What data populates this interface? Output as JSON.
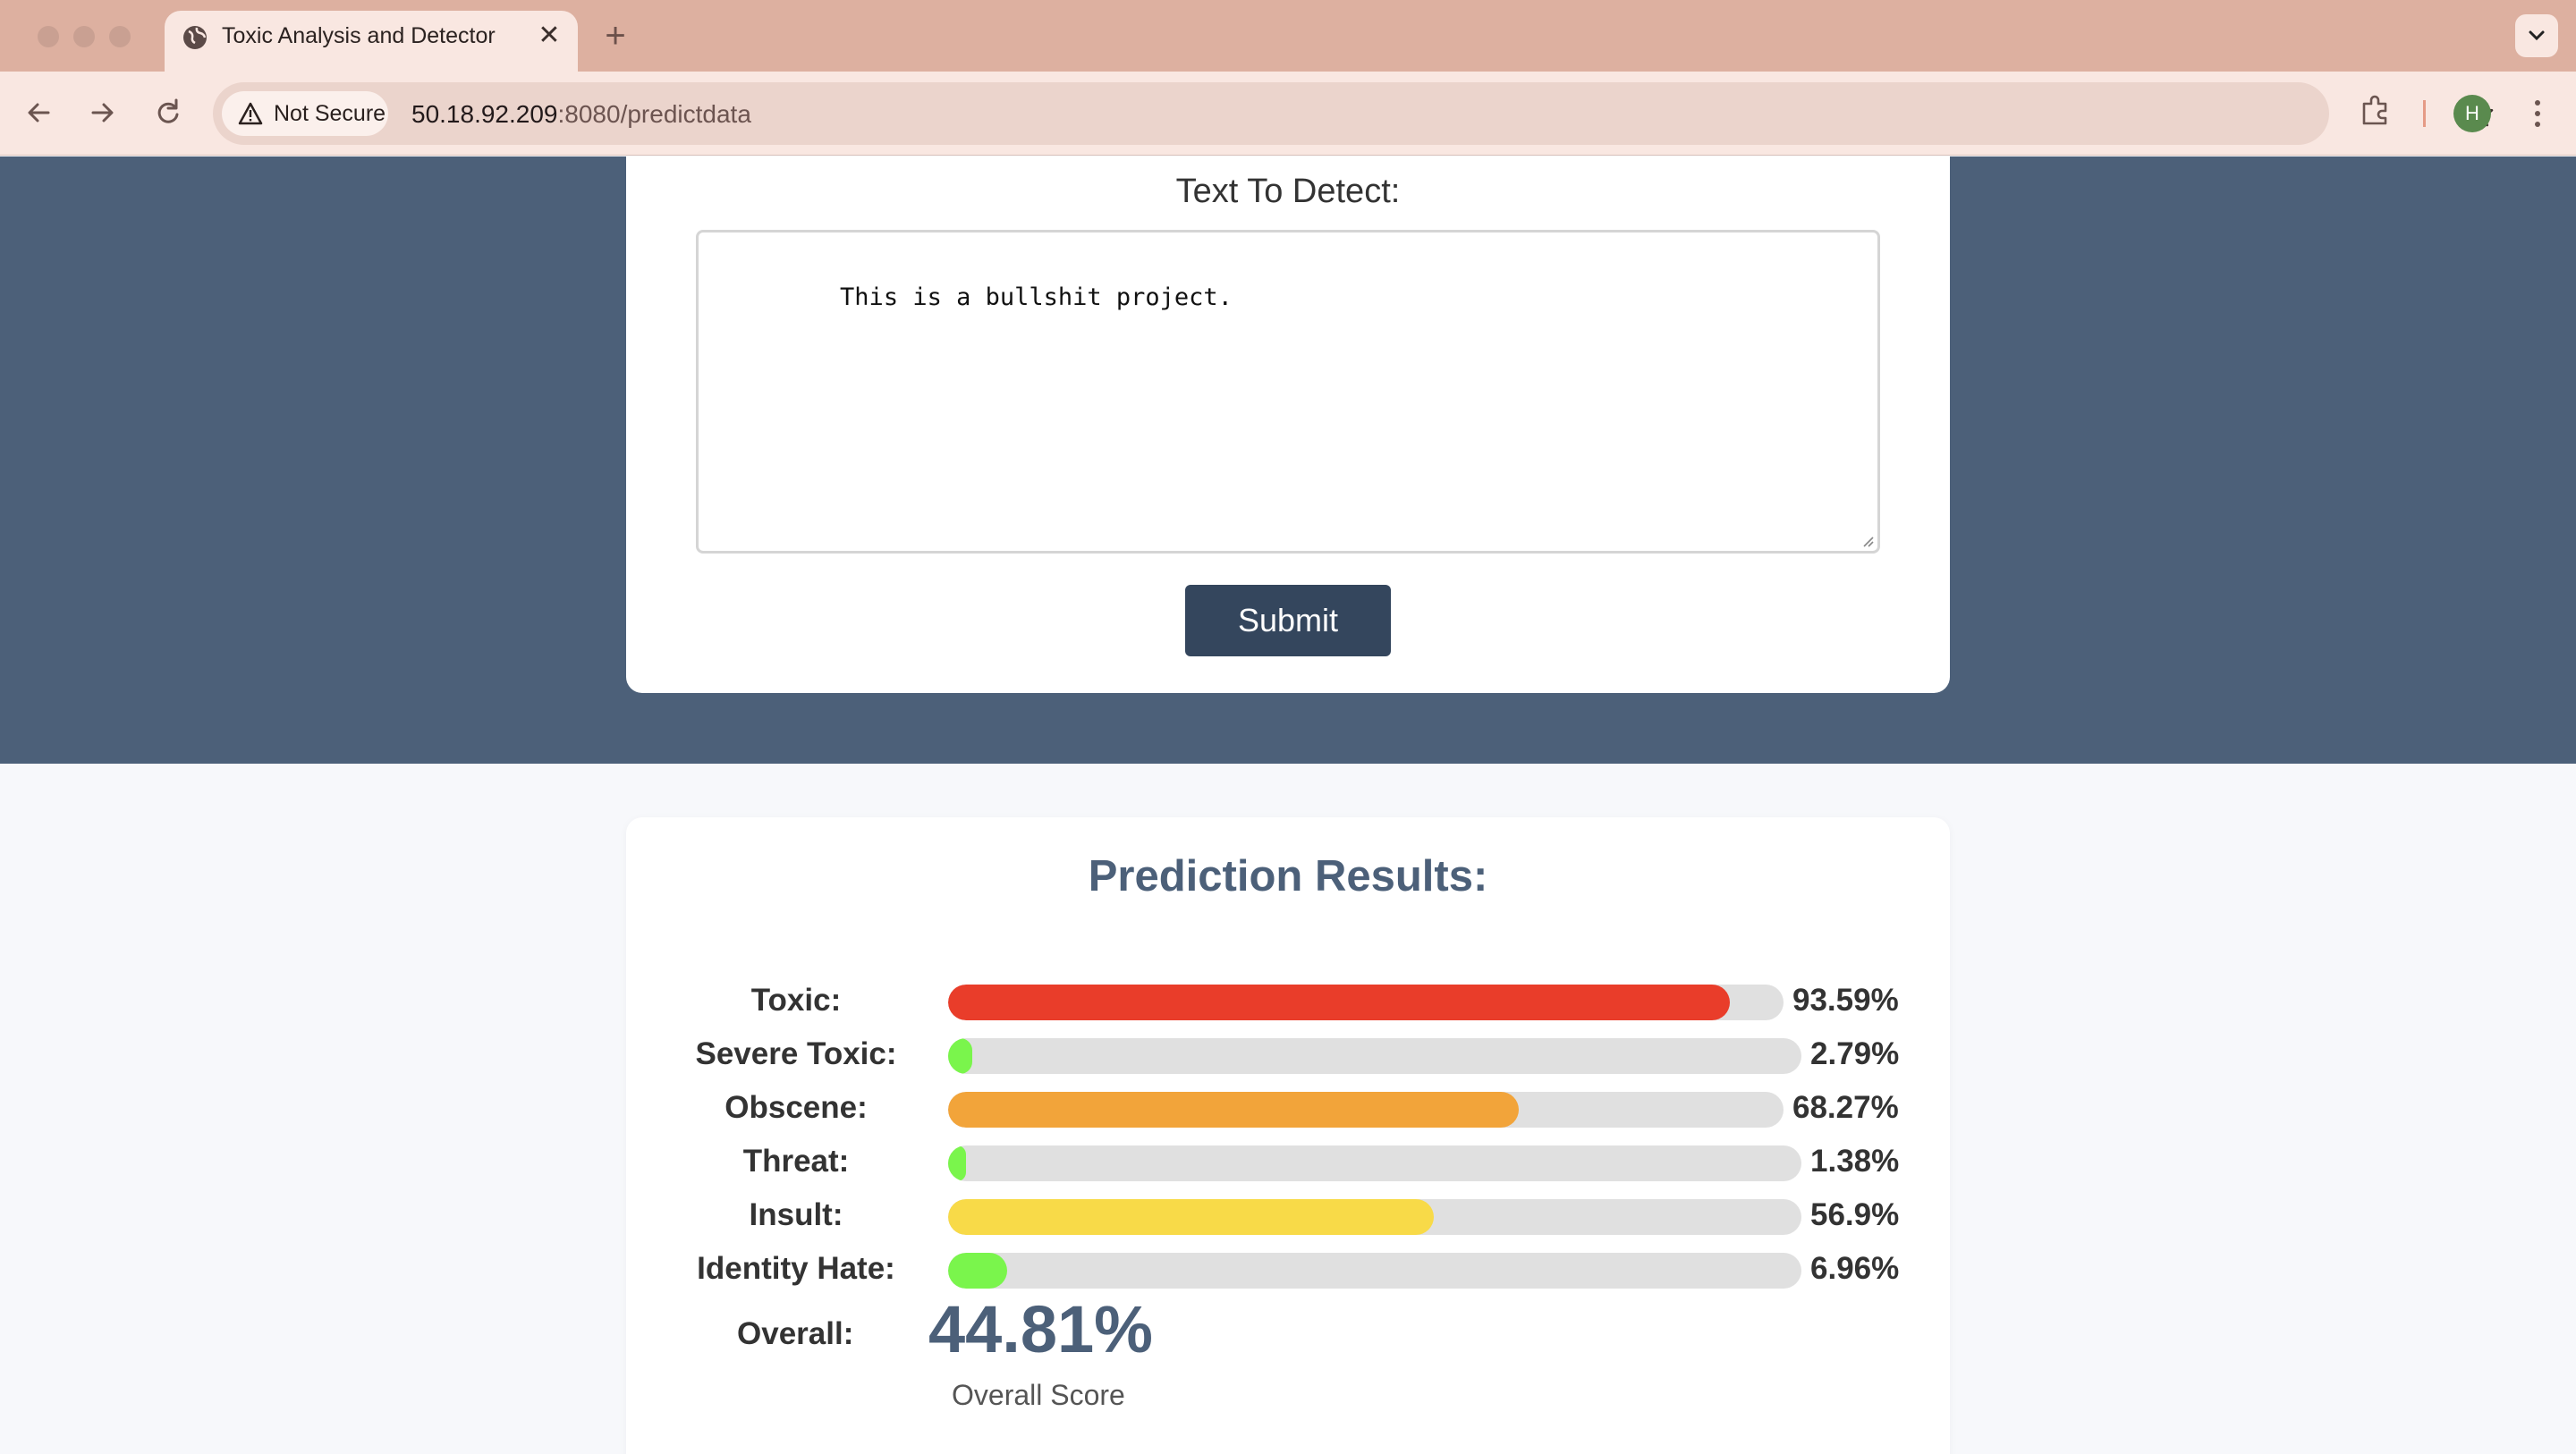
{
  "browser": {
    "tab_title": "Toxic Analysis and Detector",
    "security_label": "Not Secure",
    "url_host": "50.18.92.209",
    "url_path": ":8080/predictdata",
    "profile_initial": "H"
  },
  "form": {
    "label": "Text To Detect:",
    "text_value": "This is a bullshit project.",
    "submit_label": "Submit"
  },
  "results": {
    "title": "Prediction Results:",
    "rows": [
      {
        "label": "Toxic:",
        "value": "93.59%",
        "level": 0.9359,
        "color": "#e93d2a"
      },
      {
        "label": "Severe Toxic:",
        "value": "2.79%",
        "level": 0.0279,
        "color": "#7af54c"
      },
      {
        "label": "Obscene:",
        "value": "68.27%",
        "level": 0.6827,
        "color": "#f2a43a"
      },
      {
        "label": "Threat:",
        "value": "1.38%",
        "level": 0.0138,
        "color": "#7af54c"
      },
      {
        "label": "Insult:",
        "value": "56.9%",
        "level": 0.569,
        "color": "#f8da48"
      },
      {
        "label": "Identity Hate:",
        "value": "6.96%",
        "level": 0.0696,
        "color": "#7af54c"
      }
    ],
    "overall_label": "Overall:",
    "overall_value": "44.81%",
    "overall_caption": "Overall Score"
  },
  "colors": {
    "hero_background": "#4c6079",
    "button": "#34465d",
    "title": "#4c6079"
  }
}
